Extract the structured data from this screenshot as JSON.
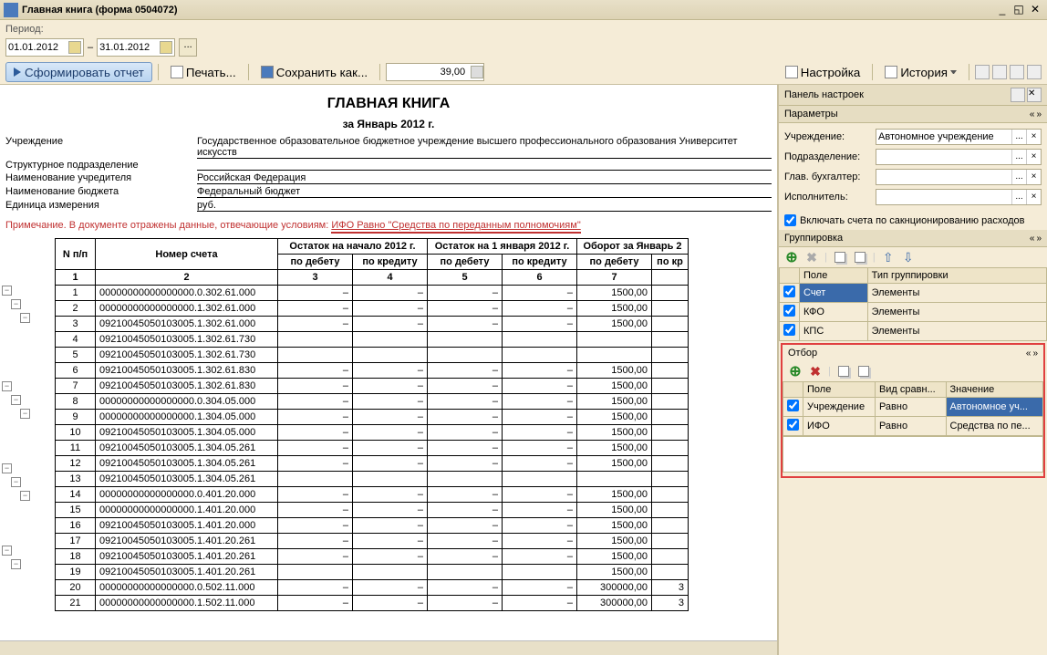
{
  "title": "Главная книга (форма 0504072)",
  "period_label": "Период:",
  "date_from": "01.01.2012",
  "date_to": "31.01.2012",
  "buttons": {
    "form_report": "Сформировать отчет",
    "print": "Печать...",
    "save_as": "Сохранить как...",
    "settings": "Настройка",
    "history": "История"
  },
  "zoom": "39,00",
  "report": {
    "title": "ГЛАВНАЯ КНИГА",
    "subtitle": "за Январь 2012 г.",
    "org": "Государственное образовательное бюджетное учреждение высшего профессионального образования   Университет искусств",
    "rows": [
      {
        "label": "Учреждение",
        "value": ""
      },
      {
        "label": "Структурное подразделение",
        "value": ""
      },
      {
        "label": "Наименование учредителя",
        "value": "Российская Федерация"
      },
      {
        "label": "Наименование бюджета",
        "value": "Федеральный бюджет"
      },
      {
        "label": "Единица измерения",
        "value": "руб."
      }
    ],
    "note_prefix": "Примечание. В документе отражены данные, отвечающие условиям: ",
    "note_underlined": "ИФО Равно \"Средства по переданным полномочиям\""
  },
  "data_headers": {
    "n": "N п/п",
    "account": "Номер счета",
    "bal_start": "Остаток на начало 2012 г.",
    "bal_jan1": "Остаток на 1 января 2012 г.",
    "turnover": "Оборот за Январь 2",
    "debit": "по дебету",
    "credit": "по кредиту",
    "col_kr": "по кр"
  },
  "col_nums": [
    "1",
    "2",
    "3",
    "4",
    "5",
    "6",
    "7"
  ],
  "data_rows": [
    {
      "n": 1,
      "acc": "00000000000000000.0.302.61.000",
      "d1": "–",
      "c1": "–",
      "d2": "–",
      "c2": "–",
      "t": "1500,00"
    },
    {
      "n": 2,
      "acc": "00000000000000000.1.302.61.000",
      "d1": "–",
      "c1": "–",
      "d2": "–",
      "c2": "–",
      "t": "1500,00"
    },
    {
      "n": 3,
      "acc": "09210045050103005.1.302.61.000",
      "d1": "–",
      "c1": "–",
      "d2": "–",
      "c2": "–",
      "t": "1500,00"
    },
    {
      "n": 4,
      "acc": "09210045050103005.1.302.61.730",
      "d1": "",
      "c1": "",
      "d2": "",
      "c2": "",
      "t": ""
    },
    {
      "n": 5,
      "acc": "09210045050103005.1.302.61.730",
      "d1": "",
      "c1": "",
      "d2": "",
      "c2": "",
      "t": ""
    },
    {
      "n": 6,
      "acc": "09210045050103005.1.302.61.830",
      "d1": "–",
      "c1": "–",
      "d2": "–",
      "c2": "–",
      "t": "1500,00"
    },
    {
      "n": 7,
      "acc": "09210045050103005.1.302.61.830",
      "d1": "–",
      "c1": "–",
      "d2": "–",
      "c2": "–",
      "t": "1500,00"
    },
    {
      "n": 8,
      "acc": "00000000000000000.0.304.05.000",
      "d1": "–",
      "c1": "–",
      "d2": "–",
      "c2": "–",
      "t": "1500,00"
    },
    {
      "n": 9,
      "acc": "00000000000000000.1.304.05.000",
      "d1": "–",
      "c1": "–",
      "d2": "–",
      "c2": "–",
      "t": "1500,00"
    },
    {
      "n": 10,
      "acc": "09210045050103005.1.304.05.000",
      "d1": "–",
      "c1": "–",
      "d2": "–",
      "c2": "–",
      "t": "1500,00"
    },
    {
      "n": 11,
      "acc": "09210045050103005.1.304.05.261",
      "d1": "–",
      "c1": "–",
      "d2": "–",
      "c2": "–",
      "t": "1500,00"
    },
    {
      "n": 12,
      "acc": "09210045050103005.1.304.05.261",
      "d1": "–",
      "c1": "–",
      "d2": "–",
      "c2": "–",
      "t": "1500,00"
    },
    {
      "n": 13,
      "acc": "09210045050103005.1.304.05.261",
      "d1": "",
      "c1": "",
      "d2": "",
      "c2": "",
      "t": ""
    },
    {
      "n": 14,
      "acc": "00000000000000000.0.401.20.000",
      "d1": "–",
      "c1": "–",
      "d2": "–",
      "c2": "–",
      "t": "1500,00"
    },
    {
      "n": 15,
      "acc": "00000000000000000.1.401.20.000",
      "d1": "–",
      "c1": "–",
      "d2": "–",
      "c2": "–",
      "t": "1500,00"
    },
    {
      "n": 16,
      "acc": "09210045050103005.1.401.20.000",
      "d1": "–",
      "c1": "–",
      "d2": "–",
      "c2": "–",
      "t": "1500,00"
    },
    {
      "n": 17,
      "acc": "09210045050103005.1.401.20.261",
      "d1": "–",
      "c1": "–",
      "d2": "–",
      "c2": "–",
      "t": "1500,00"
    },
    {
      "n": 18,
      "acc": "09210045050103005.1.401.20.261",
      "d1": "–",
      "c1": "–",
      "d2": "–",
      "c2": "–",
      "t": "1500,00"
    },
    {
      "n": 19,
      "acc": "09210045050103005.1.401.20.261",
      "d1": "",
      "c1": "",
      "d2": "",
      "c2": "",
      "t": "1500,00"
    },
    {
      "n": 20,
      "acc": "00000000000000000.0.502.11.000",
      "d1": "–",
      "c1": "–",
      "d2": "–",
      "c2": "–",
      "t": "300000,00",
      "e": "3"
    },
    {
      "n": 21,
      "acc": "00000000000000000.1.502.11.000",
      "d1": "–",
      "c1": "–",
      "d2": "–",
      "c2": "–",
      "t": "300000,00",
      "e": "3"
    }
  ],
  "side": {
    "panel_title": "Панель настроек",
    "parameters": "Параметры",
    "grouping": "Группировка",
    "filter": "Отбор",
    "param_fields": [
      {
        "label": "Учреждение:",
        "value": "Автономное учреждение"
      },
      {
        "label": "Подразделение:",
        "value": ""
      },
      {
        "label": "Глав. бухгалтер:",
        "value": ""
      },
      {
        "label": "Исполнитель:",
        "value": ""
      }
    ],
    "checkbox_label": "Включать счета по сакнционированию расходов",
    "group_headers": {
      "field": "Поле",
      "type": "Тип группировки"
    },
    "group_rows": [
      {
        "chk": true,
        "field": "Счет",
        "type": "Элементы",
        "sel": true
      },
      {
        "chk": true,
        "field": "КФО",
        "type": "Элементы"
      },
      {
        "chk": true,
        "field": "КПС",
        "type": "Элементы"
      }
    ],
    "filter_headers": {
      "field": "Поле",
      "cond": "Вид сравн...",
      "val": "Значение"
    },
    "filter_rows": [
      {
        "chk": true,
        "field": "Учреждение",
        "cond": "Равно",
        "val": "Автономное уч...",
        "sel": true
      },
      {
        "chk": true,
        "field": "ИФО",
        "cond": "Равно",
        "val": "Средства по пе..."
      }
    ]
  }
}
